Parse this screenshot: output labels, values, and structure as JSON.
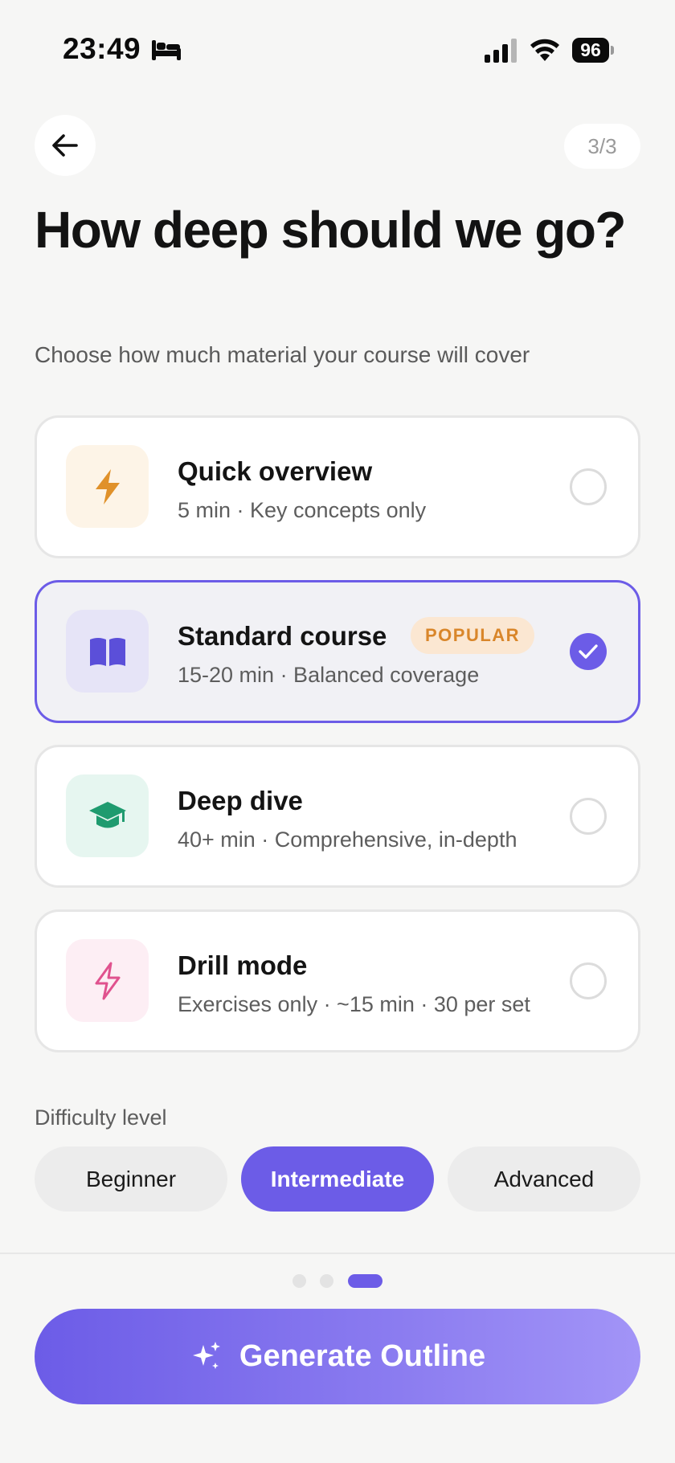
{
  "status_bar": {
    "time": "23:49",
    "battery": "96"
  },
  "header": {
    "step": "3/3"
  },
  "title": "How deep should we go?",
  "subtitle": "Choose how much material your course will cover",
  "options": [
    {
      "title": "Quick overview",
      "desc": "5 min · Key concepts only",
      "icon": "lightning-bolt-icon",
      "color": "#e0912a",
      "bg": "#fdf4e7",
      "selected": false
    },
    {
      "title": "Standard course",
      "desc": "15-20 min · Balanced coverage",
      "badge": "POPULAR",
      "icon": "open-book-icon",
      "color": "#5b4fd9",
      "bg": "#e6e4f7",
      "selected": true
    },
    {
      "title": "Deep dive",
      "desc": "40+ min · Comprehensive, in-depth",
      "icon": "graduation-cap-icon",
      "color": "#1f9b6f",
      "bg": "#e6f6f0",
      "selected": false
    },
    {
      "title": "Drill mode",
      "desc": "Exercises only · ~15 min · 30 per set",
      "icon": "lightning-outline-icon",
      "color": "#e0528e",
      "bg": "#fdeef4",
      "selected": false
    }
  ],
  "difficulty": {
    "label": "Difficulty level",
    "options": [
      "Beginner",
      "Intermediate",
      "Advanced"
    ],
    "selected": "Intermediate"
  },
  "pagination": {
    "total": 3,
    "current": 3
  },
  "generate_button": {
    "label": "Generate Outline"
  },
  "colors": {
    "accent": "#6c5ce7",
    "background": "#f6f6f5"
  }
}
